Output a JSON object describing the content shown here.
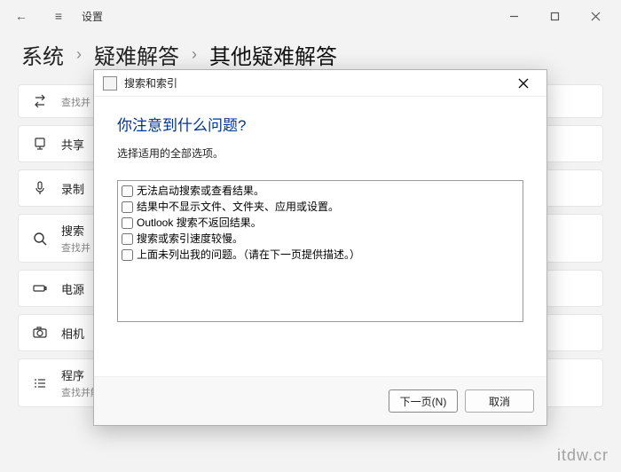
{
  "app_title": "设置",
  "breadcrumb": {
    "level1": "系统",
    "level2": "疑难解答",
    "level3": "其他疑难解答"
  },
  "sidebar": {
    "items": [
      {
        "label": "",
        "desc": "查找并",
        "icon": "arrows-icon"
      },
      {
        "label": "共享",
        "desc": "",
        "icon": "share-icon"
      },
      {
        "label": "录制",
        "desc": "",
        "icon": "mic-icon"
      },
      {
        "label": "搜索",
        "desc": "查找并",
        "icon": "search-icon"
      },
      {
        "label": "电源",
        "desc": "",
        "icon": "battery-icon"
      },
      {
        "label": "相机",
        "desc": "",
        "icon": "camera-icon"
      },
      {
        "label": "程序",
        "desc": "查找并解决在此版本的 Windows 上运行旧程序的问题。",
        "icon": "list-icon"
      }
    ]
  },
  "modal": {
    "title": "搜索和索引",
    "heading": "你注意到什么问题?",
    "subtext": "选择适用的全部选项。",
    "options": [
      "无法启动搜索或查看结果。",
      "结果中不显示文件、文件夹、应用或设置。",
      "Outlook 搜索不返回结果。",
      "搜索或索引速度较慢。",
      "上面未列出我的问题。（请在下一页提供描述。）"
    ],
    "next_label": "下一页(N)",
    "cancel_label": "取消"
  },
  "watermark": "itdw.cr"
}
